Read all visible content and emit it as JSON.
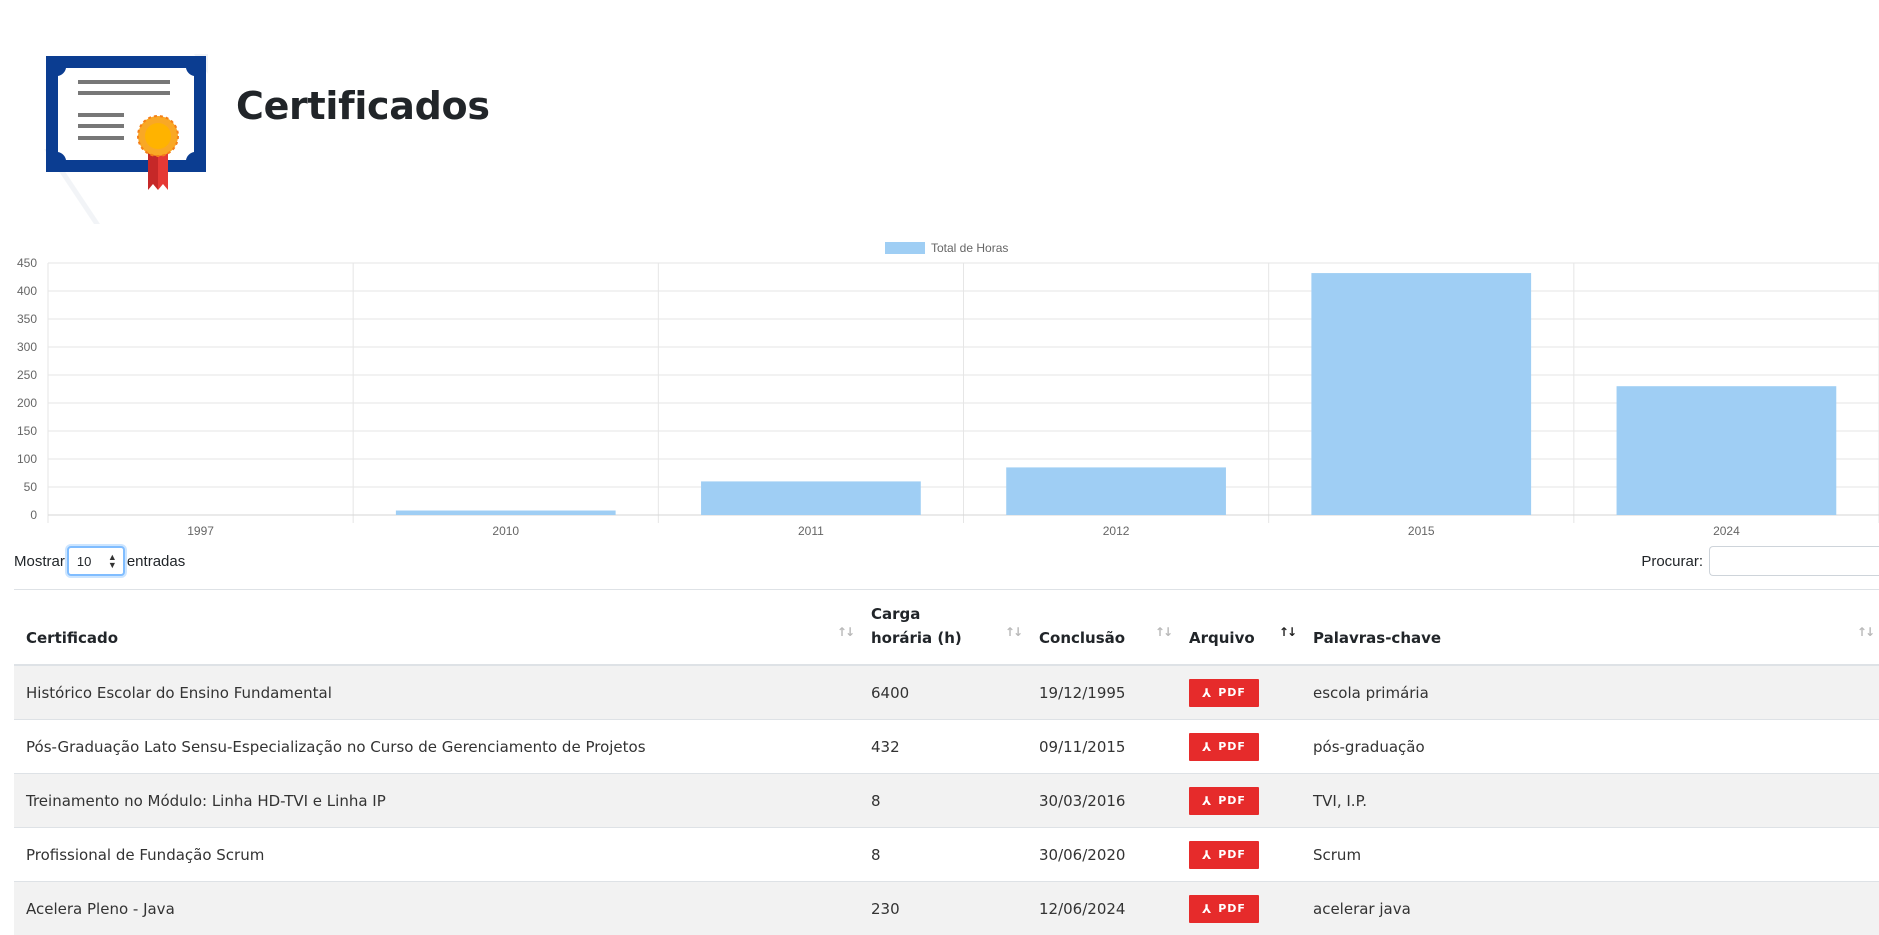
{
  "header": {
    "title": "Certificados"
  },
  "chart_data": {
    "type": "bar",
    "categories": [
      "1997",
      "2010",
      "2011",
      "2012",
      "2015",
      "2024"
    ],
    "series": [
      {
        "name": "Total de Horas",
        "values": [
          0,
          8,
          60,
          85,
          432,
          230
        ]
      }
    ],
    "ylim": [
      0,
      450
    ],
    "yticks": [
      0,
      50,
      100,
      150,
      200,
      250,
      300,
      350,
      400,
      450
    ],
    "grid": true,
    "legend": "top",
    "colors": {
      "fill": "#9fcef4",
      "grid": "#e6e6e6",
      "text": "#666666"
    }
  },
  "controls": {
    "show_label": "Mostrar",
    "entries_value": "10",
    "entries_label": "entradas",
    "search_label": "Procurar:",
    "search_value": ""
  },
  "table": {
    "columns": [
      "Certificado",
      "Carga horária (h)",
      "Conclusão",
      "Arquivo",
      "Palavras-chave"
    ],
    "rows": [
      {
        "certificado": "Histórico Escolar do Ensino Fundamental",
        "carga": "6400",
        "conclusao": "19/12/1995",
        "arquivo": "PDF",
        "palavras": "escola primária"
      },
      {
        "certificado": "Pós-Graduação Lato Sensu-Especialização no Curso de Gerenciamento de Projetos",
        "carga": "432",
        "conclusao": "09/11/2015",
        "arquivo": "PDF",
        "palavras": "pós-graduação"
      },
      {
        "certificado": "Treinamento no Módulo: Linha HD-TVI e Linha IP",
        "carga": "8",
        "conclusao": "30/03/2016",
        "arquivo": "PDF",
        "palavras": "TVI, I.P."
      },
      {
        "certificado": "Profissional de Fundação Scrum",
        "carga": "8",
        "conclusao": "30/06/2020",
        "arquivo": "PDF",
        "palavras": "Scrum"
      },
      {
        "certificado": "Acelera Pleno - Java",
        "carga": "230",
        "conclusao": "12/06/2024",
        "arquivo": "PDF",
        "palavras": "acelerar java"
      }
    ]
  },
  "colors": {
    "pdf_badge": "#e62b2b",
    "logo_blue": "#0b3d91",
    "ribbon_red": "#d32f2f",
    "seal_gold": "#f9a825"
  }
}
